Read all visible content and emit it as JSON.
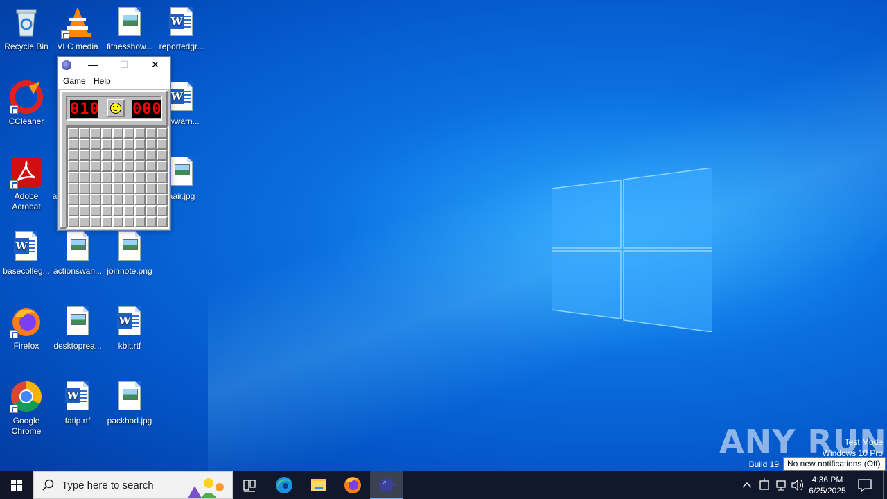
{
  "desktop": {
    "icons": [
      {
        "label": "Recycle Bin",
        "icon": "recycle-bin-icon"
      },
      {
        "label": "VLC media player",
        "icon": "vlc-icon"
      },
      {
        "label": "fitnesshow...",
        "icon": "image-file-icon"
      },
      {
        "label": "reportedgr...",
        "icon": "word-doc-icon"
      },
      {
        "label": "CCleaner",
        "icon": "ccleaner-icon"
      },
      {
        "label": "ewwarn...",
        "icon": "word-doc-icon"
      },
      {
        "label": "Adobe Acrobat",
        "icon": "adobe-acrobat-icon"
      },
      {
        "label": "a",
        "icon": "file-icon"
      },
      {
        "label": "aair.jpg",
        "icon": "image-file-icon"
      },
      {
        "label": "basecolleg...",
        "icon": "word-doc-icon"
      },
      {
        "label": "actionswan...",
        "icon": "image-file-icon"
      },
      {
        "label": "joinnote.png",
        "icon": "image-file-icon"
      },
      {
        "label": "Firefox",
        "icon": "firefox-icon"
      },
      {
        "label": "desktoprea...",
        "icon": "image-file-icon"
      },
      {
        "label": "kbit.rtf",
        "icon": "word-doc-icon"
      },
      {
        "label": "Google Chrome",
        "icon": "chrome-icon"
      },
      {
        "label": "fatip.rtf",
        "icon": "word-doc-icon"
      },
      {
        "label": "packhad.jpg",
        "icon": "image-file-icon"
      }
    ]
  },
  "minesweeper": {
    "menu": {
      "game": "Game",
      "help": "Help"
    },
    "mine_counter": "010",
    "timer": "000",
    "rows": 9,
    "cols": 9,
    "title_buttons": {
      "minimize": "—",
      "maximize": "☐",
      "close": "✕"
    }
  },
  "watermark": {
    "brand": "ANY RUN",
    "line1": "Test Mode",
    "line2": "Windows 10 Pro",
    "line3": "Build 19"
  },
  "notification_tooltip": "No new notifications (Off)",
  "taskbar": {
    "search_placeholder": "Type here to search",
    "time": "4:36 PM",
    "date": "6/25/2025",
    "apps": [
      "task-view-icon",
      "edge-icon",
      "file-explorer-icon",
      "firefox-icon",
      "minesweeper-icon"
    ]
  },
  "colors": {
    "led_red": "#ff0000",
    "panel_gray": "#c0c0c0",
    "desktop_blue": "#0a6fe0"
  }
}
